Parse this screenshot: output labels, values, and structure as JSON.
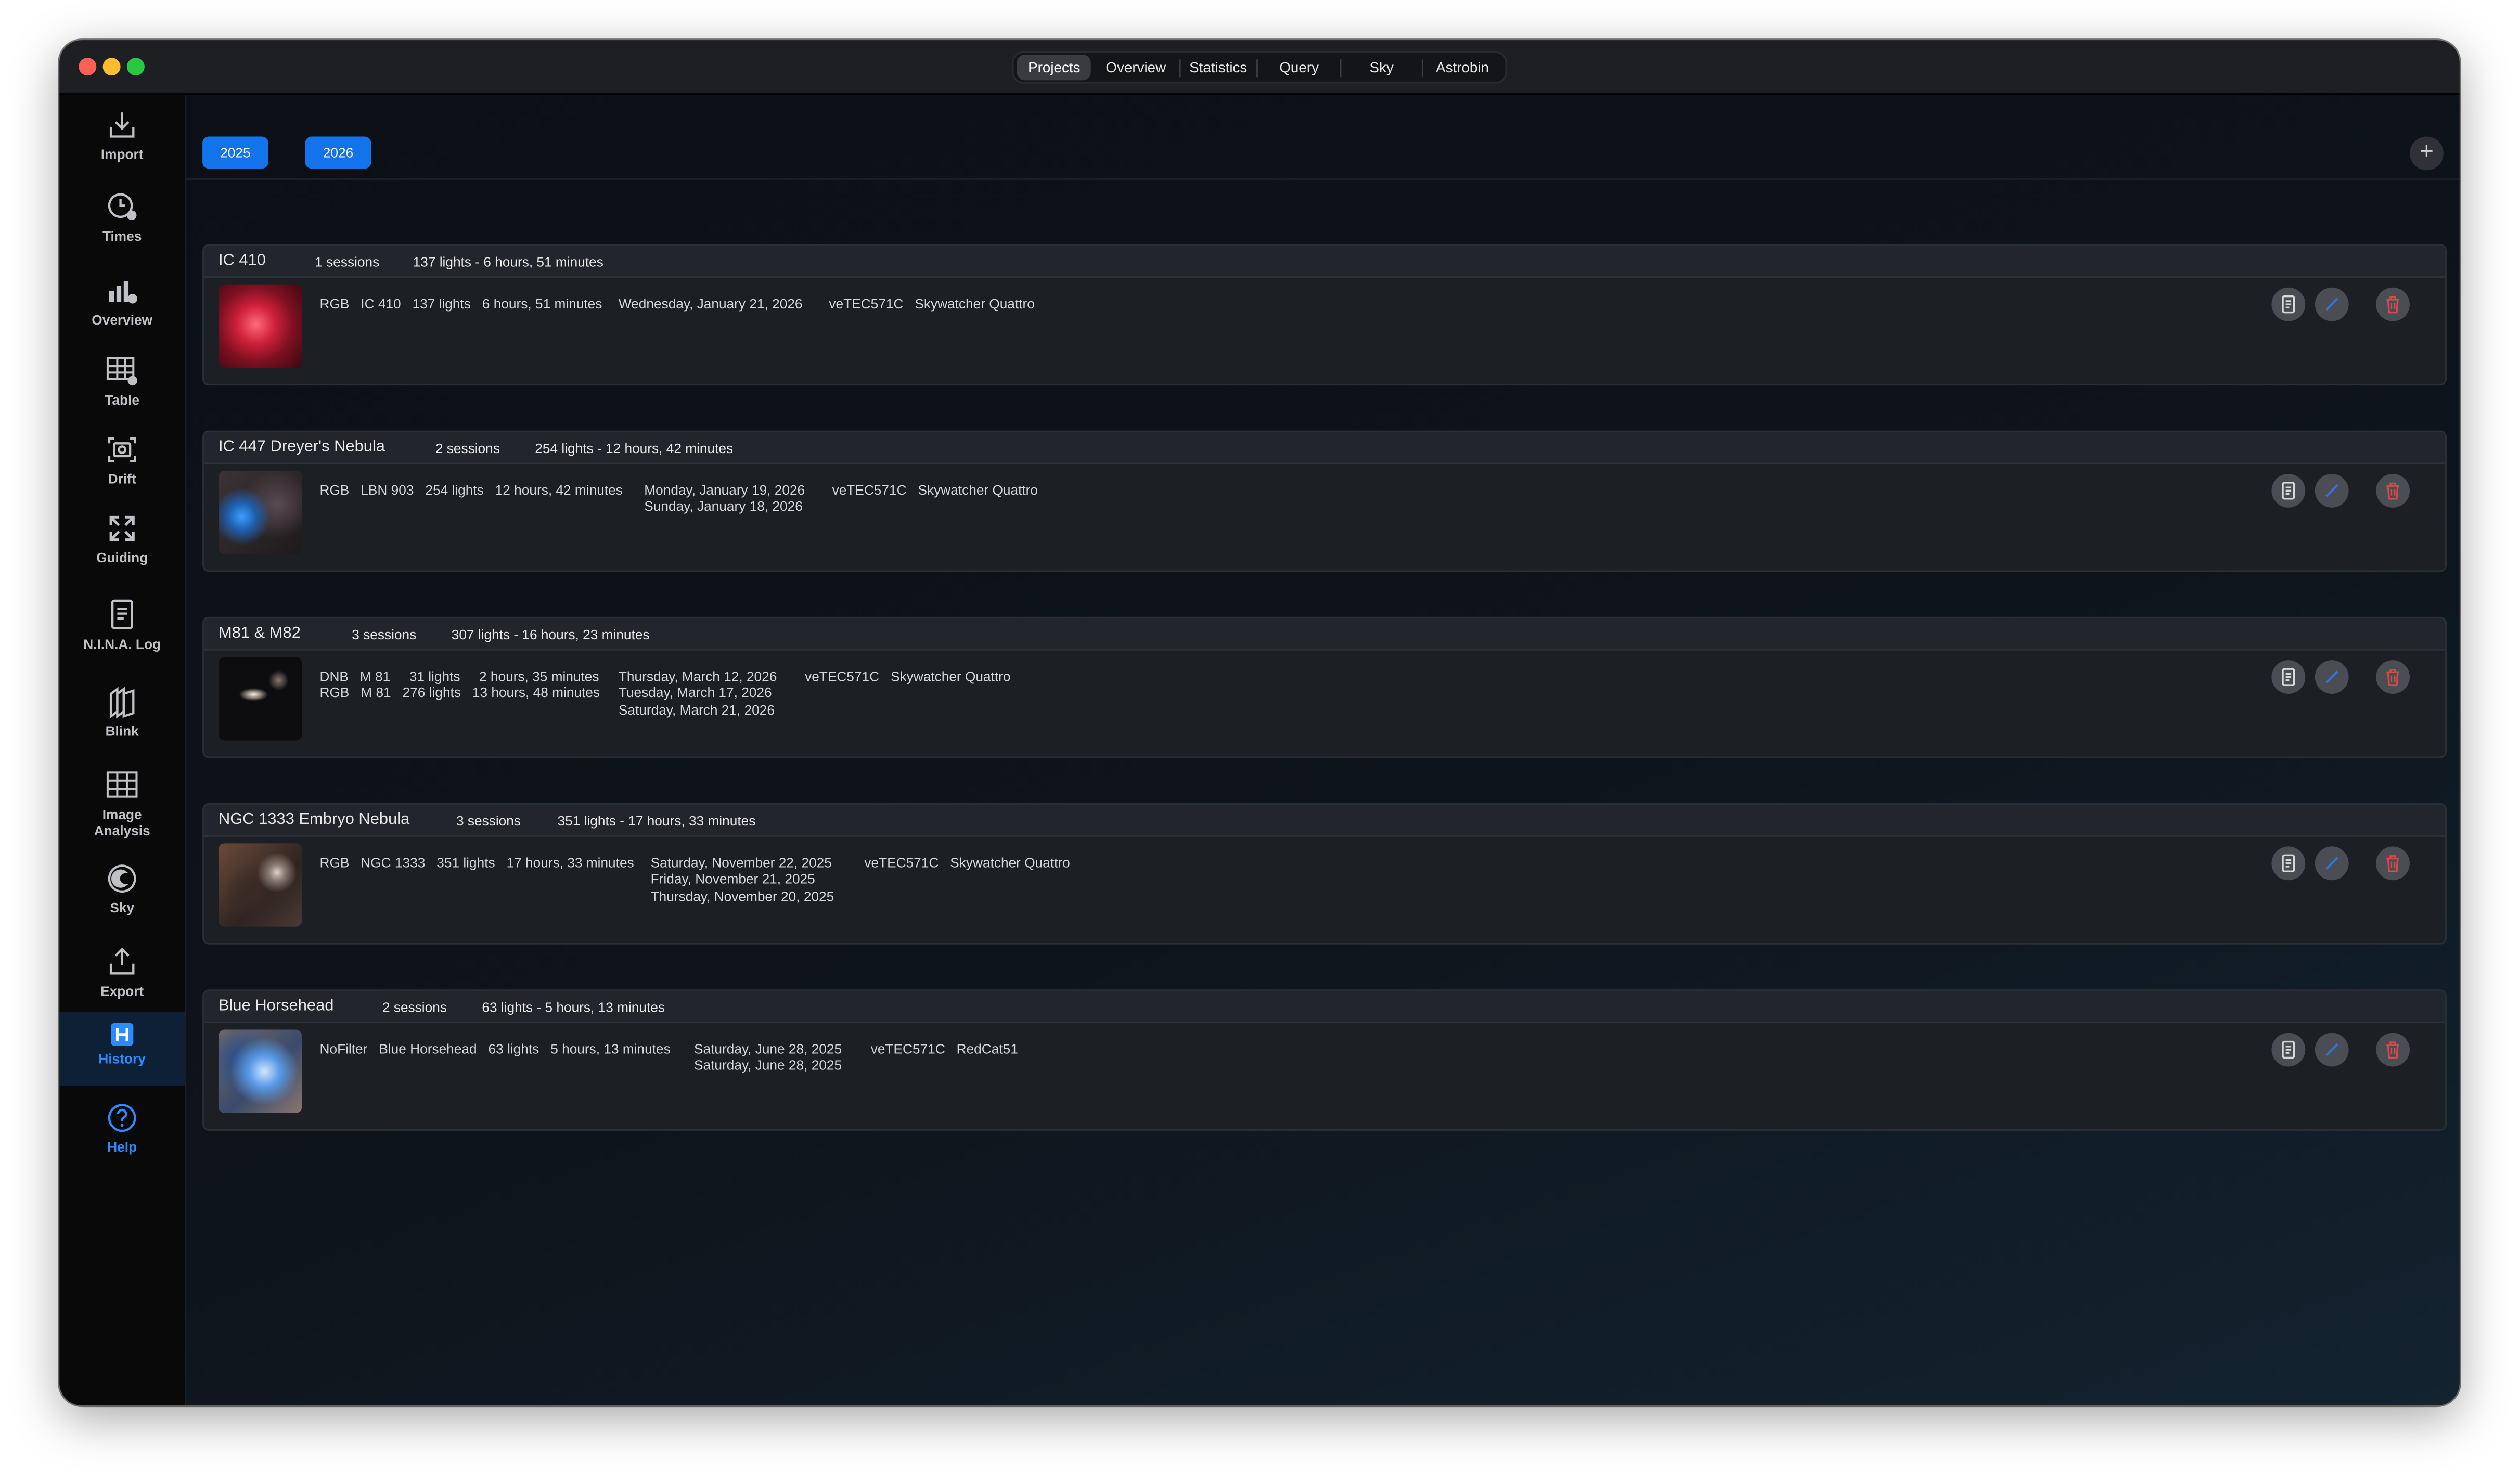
{
  "tabs": [
    {
      "label": "Projects",
      "active": true
    },
    {
      "label": "Overview",
      "active": false
    },
    {
      "label": "Statistics",
      "active": false
    },
    {
      "label": "Query",
      "active": false
    },
    {
      "label": "Sky",
      "active": false
    },
    {
      "label": "Astrobin",
      "active": false
    }
  ],
  "sidebar": {
    "items": [
      {
        "label": "Import",
        "icon": "import-icon"
      },
      {
        "label": "Times",
        "icon": "clock-icon"
      },
      {
        "label": "Overview",
        "icon": "bar-chart-icon"
      },
      {
        "label": "Table",
        "icon": "table-icon"
      },
      {
        "label": "Drift",
        "icon": "camera-drift-icon"
      },
      {
        "label": "Guiding",
        "icon": "arrows-expand-icon"
      },
      {
        "label": "N.I.N.A. Log",
        "icon": "document-icon"
      },
      {
        "label": "Blink",
        "icon": "stacked-frames-icon"
      },
      {
        "label": "Image",
        "label2": "Analysis",
        "icon": "grid-icon"
      },
      {
        "label": "Sky",
        "icon": "moon-icon"
      },
      {
        "label": "Export",
        "icon": "export-icon"
      },
      {
        "label": "History",
        "icon": "h-box-icon",
        "active": true
      },
      {
        "label": "Help",
        "icon": "question-circle-icon"
      }
    ]
  },
  "years": [
    "2025",
    "2026"
  ],
  "add_button": "+",
  "colors": {
    "accent": "#1273ea",
    "sidebar_active_text": "#2a8cff",
    "delete": "#d64a4a",
    "edit": "#3b6fd8"
  },
  "projects": [
    {
      "name": "IC 410",
      "sessions": "1 sessions",
      "summary": "137 lights  - 6 hours, 51 minutes",
      "rows": [
        {
          "filter": "RGB",
          "target": "IC 410",
          "lights": "137 lights",
          "duration": "6 hours, 51 minutes"
        }
      ],
      "dates": [
        "Wednesday, January 21, 2026"
      ],
      "camera": "veTEC571C",
      "scope": "Skywatcher Quattro"
    },
    {
      "name": "IC 447 Dreyer's Nebula",
      "sessions": "2 sessions",
      "summary": "254 lights  - 12 hours, 42 minutes",
      "rows": [
        {
          "filter": "RGB",
          "target": "LBN 903",
          "lights": "254 lights",
          "duration": "12 hours, 42 minutes"
        }
      ],
      "dates": [
        "Monday, January 19, 2026",
        "Sunday, January 18, 2026"
      ],
      "camera": "veTEC571C",
      "scope": "Skywatcher Quattro"
    },
    {
      "name": "M81 & M82",
      "sessions": "3 sessions",
      "summary": "307 lights  - 16 hours, 23 minutes",
      "rows": [
        {
          "filter": "DNB",
          "target": "M 81",
          "lights": "31 lights",
          "duration": "2 hours, 35 minutes"
        },
        {
          "filter": "RGB",
          "target": "M 81",
          "lights": "276 lights",
          "duration": "13 hours, 48 minutes"
        }
      ],
      "dates": [
        "Thursday, March 12, 2026",
        "Tuesday, March 17, 2026",
        "Saturday, March 21, 2026"
      ],
      "camera": "veTEC571C",
      "scope": "Skywatcher Quattro"
    },
    {
      "name": "NGC 1333 Embryo Nebula",
      "sessions": "3 sessions",
      "summary": "351 lights  - 17 hours, 33 minutes",
      "rows": [
        {
          "filter": "RGB",
          "target": "NGC 1333",
          "lights": "351 lights",
          "duration": "17 hours, 33 minutes"
        }
      ],
      "dates": [
        "Saturday, November 22, 2025",
        "Friday, November 21, 2025",
        "Thursday, November 20, 2025"
      ],
      "camera": "veTEC571C",
      "scope": "Skywatcher Quattro"
    },
    {
      "name": "Blue Horsehead",
      "sessions": "2 sessions",
      "summary": "63 lights  - 5 hours, 13 minutes",
      "rows": [
        {
          "filter": "NoFilter",
          "target": "Blue Horsehead",
          "lights": "63 lights",
          "duration": "5 hours, 13 minutes"
        }
      ],
      "dates": [
        "Saturday, June 28, 2025",
        "Saturday, June 28, 2025"
      ],
      "camera": "veTEC571C",
      "scope": "RedCat51"
    }
  ]
}
